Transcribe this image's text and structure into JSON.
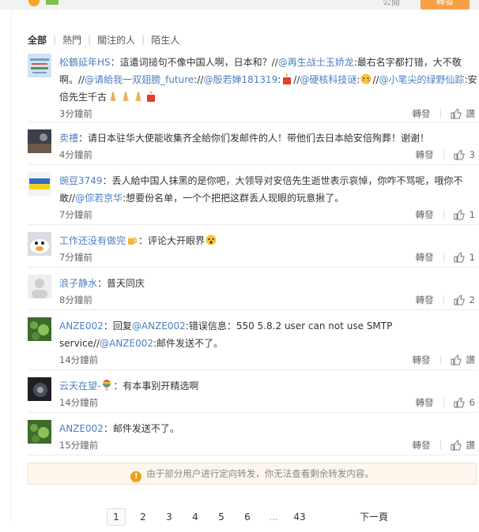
{
  "top": {
    "public_label": "公開",
    "button_label": "轉發"
  },
  "filters": [
    "全部",
    "熱門",
    "關注的人",
    "陌生人"
  ],
  "comments": [
    {
      "name": "松鶴延年HS",
      "parts": [
        {
          "t": "：這遣词搥句不像中国人啊，日本和？//"
        },
        {
          "m": "@再生战士玉娇龙"
        },
        {
          "t": ":最右名字都打错，大不敬啊。//"
        },
        {
          "m": "@请給我一双翅膀_future"
        },
        {
          "t": "://"
        },
        {
          "m": "@殷若婵181319"
        },
        {
          "t": ":"
        },
        {
          "e": "candle"
        },
        {
          "t": "//"
        },
        {
          "m": "@硬核科技谜"
        },
        {
          "t": ":"
        },
        {
          "e": "face"
        },
        {
          "t": "//"
        },
        {
          "m": "@小笔尖的绿野仙踪"
        },
        {
          "t": ":安倍先生千古"
        },
        {
          "e": "pray"
        },
        {
          "e": "pray"
        },
        {
          "e": "pray"
        },
        {
          "e": "candle"
        }
      ],
      "time": "3分鐘前",
      "repost": "轉發",
      "likes": "讚"
    },
    {
      "name": "卖禮",
      "parts": [
        {
          "t": "：请日本驻华大使能收集齐全給你们发邮件的人！带他们去日本給安倍殉葬！谢谢！"
        }
      ],
      "time": "4分鐘前",
      "repost": "轉發",
      "likes": "3"
    },
    {
      "name": "豌豆3749",
      "parts": [
        {
          "t": "：丢人給中国人抹黑的是你吧，大领导对安倍先生逝世表示哀悼，你咋不骂呢，哦你不敢//"
        },
        {
          "m": "@倧若京华"
        },
        {
          "t": ":想要份名单，一个个把把这群丢人现眼的玩意揪了。"
        }
      ],
      "time": "7分鐘前",
      "repost": "轉發",
      "likes": "1"
    },
    {
      "name": "工作还没有做完",
      "parts": [
        {
          "e": "beer"
        },
        {
          "t": "：评论大开眼界"
        },
        {
          "e": "wow"
        }
      ],
      "time": "7分鐘前",
      "repost": "轉發",
      "likes": "1"
    },
    {
      "name": "浪子静水",
      "parts": [
        {
          "t": "：普天同庆"
        }
      ],
      "time": "8分鐘前",
      "repost": "轉發",
      "likes": "2"
    },
    {
      "name": "ANZE002",
      "parts": [
        {
          "t": "：回复"
        },
        {
          "m": "@ANZE002"
        },
        {
          "t": ":错误信息：550 5.8.2 user can not use SMTP service//"
        },
        {
          "m": "@ANZE002"
        },
        {
          "t": ":邮件发送不了。"
        }
      ],
      "time": "14分鐘前",
      "repost": "轉發",
      "likes": "讚"
    },
    {
      "name": "云天在望-",
      "parts": [
        {
          "e": "balloon"
        },
        {
          "t": "：有本事别开精选啊"
        }
      ],
      "time": "14分鐘前",
      "repost": "轉發",
      "likes": "6"
    },
    {
      "name": "ANZE002",
      "parts": [
        {
          "t": "：邮件发送不了。"
        }
      ],
      "time": "15分鐘前",
      "repost": "轉發",
      "likes": "讚"
    }
  ],
  "notice": "由于部分用户进行定向转发，你无法查看剩余转发内容。",
  "pagination": {
    "pages": [
      "1",
      "2",
      "3",
      "4",
      "5",
      "6",
      "...",
      "43"
    ],
    "current": "1",
    "next": "下一頁"
  },
  "colors": {
    "link": "#4d7fc0",
    "accent": "#f7a046",
    "notice_bg": "#fdf6ec"
  },
  "icons": [
    "thumb-up-icon",
    "info-icon",
    "avatar-image"
  ]
}
